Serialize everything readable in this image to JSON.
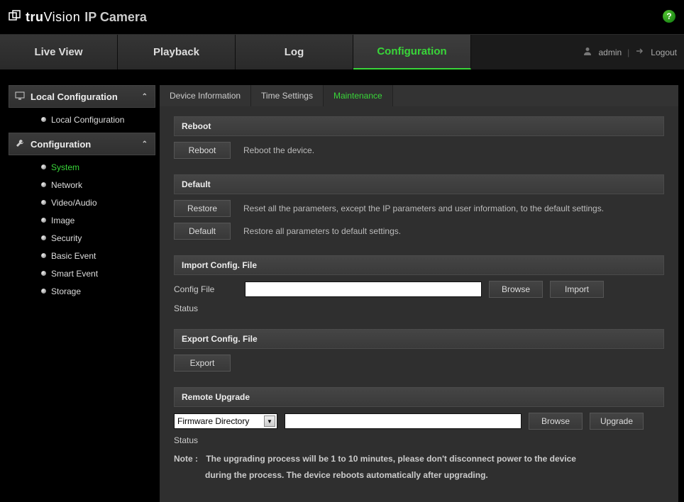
{
  "brand": {
    "name_bold": "tru",
    "name_rest": "Vision",
    "subtitle": "IP Camera"
  },
  "main_tabs": [
    "Live View",
    "Playback",
    "Log",
    "Configuration"
  ],
  "main_tab_active": 3,
  "user": {
    "name": "admin",
    "logout": "Logout"
  },
  "sidebar": {
    "groups": [
      {
        "title": "Local Configuration",
        "items": [
          "Local Configuration"
        ],
        "active": -1
      },
      {
        "title": "Configuration",
        "items": [
          "System",
          "Network",
          "Video/Audio",
          "Image",
          "Security",
          "Basic Event",
          "Smart Event",
          "Storage"
        ],
        "active": 0
      }
    ]
  },
  "sub_tabs": [
    "Device Information",
    "Time Settings",
    "Maintenance"
  ],
  "sub_tab_active": 2,
  "sections": {
    "reboot": {
      "title": "Reboot",
      "button": "Reboot",
      "desc": "Reboot the device."
    },
    "default": {
      "title": "Default",
      "restore_btn": "Restore",
      "restore_desc": "Reset all the parameters, except the IP parameters and user information, to the default settings.",
      "default_btn": "Default",
      "default_desc": "Restore all parameters to default settings."
    },
    "import": {
      "title": "Import Config. File",
      "label": "Config File",
      "value": "",
      "browse": "Browse",
      "import": "Import",
      "status_label": "Status",
      "status_value": ""
    },
    "export": {
      "title": "Export Config. File",
      "button": "Export"
    },
    "upgrade": {
      "title": "Remote Upgrade",
      "select_value": "Firmware Directory",
      "path_value": "",
      "browse": "Browse",
      "upgrade": "Upgrade",
      "status_label": "Status",
      "status_value": "",
      "note_label": "Note :",
      "note_line1": "The upgrading process will be 1 to 10 minutes, please don't disconnect power to the device",
      "note_line2": "during the process. The device reboots automatically after upgrading."
    }
  }
}
